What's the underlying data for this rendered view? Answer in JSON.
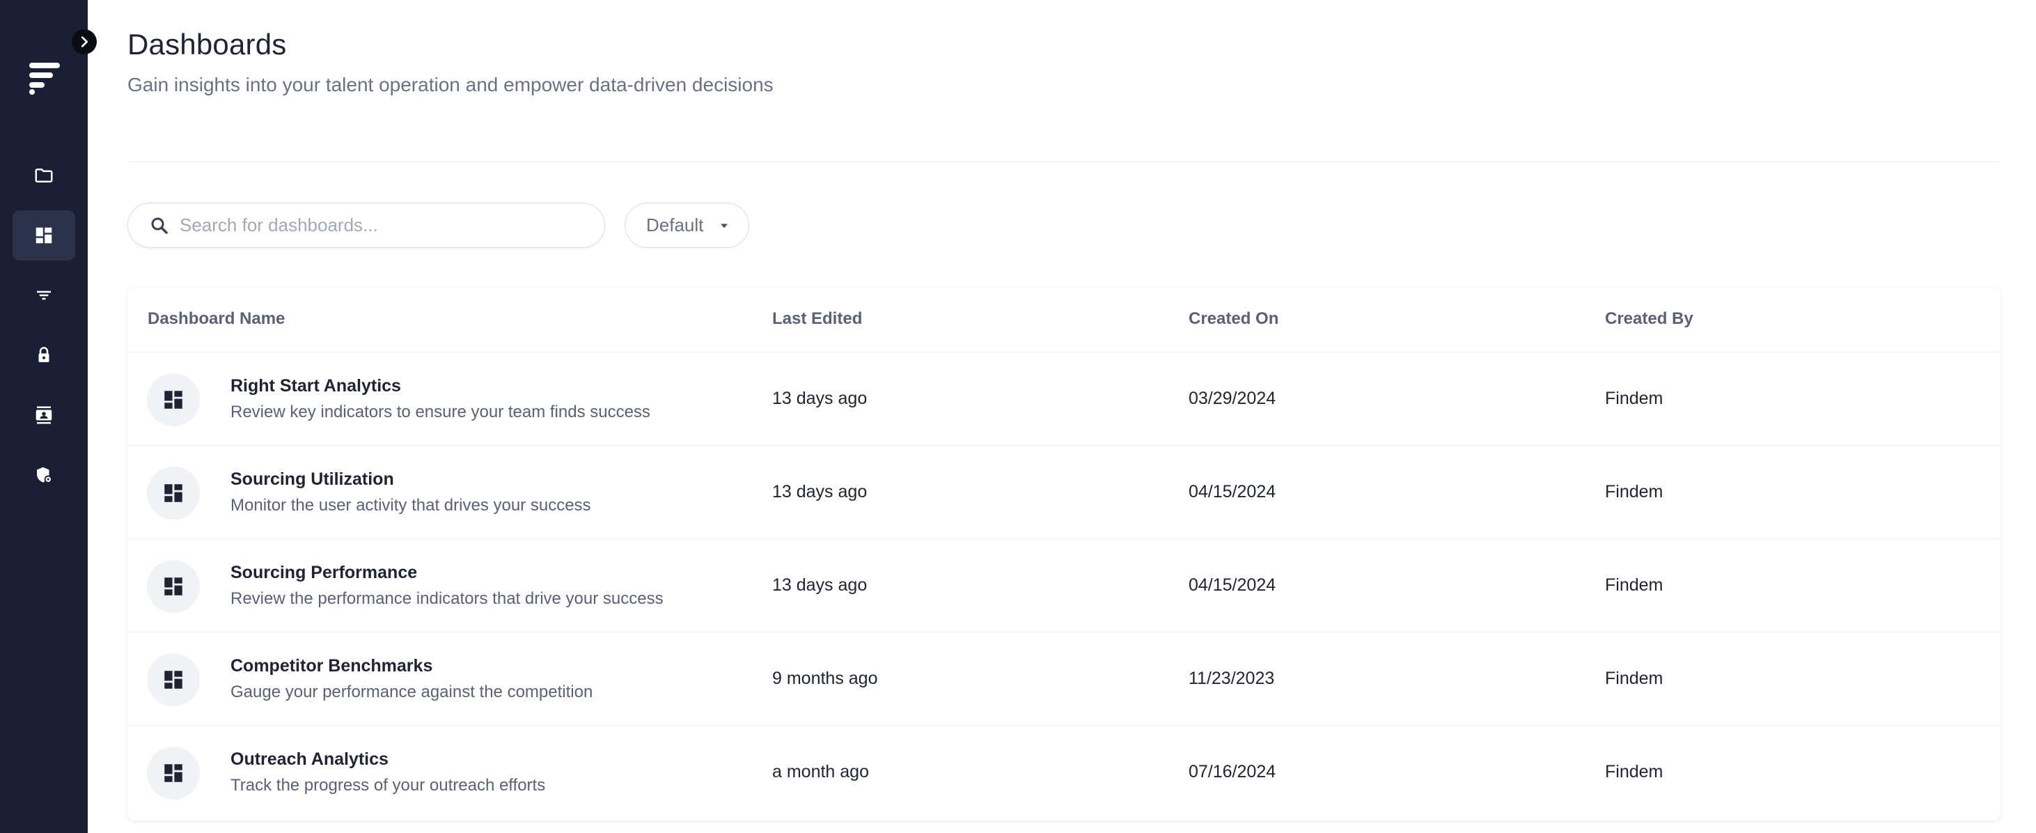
{
  "header": {
    "title": "Dashboards",
    "subtitle": "Gain insights into your talent operation and empower data-driven decisions"
  },
  "sidebar": {
    "items": [
      {
        "icon": "folder-icon",
        "active": false
      },
      {
        "icon": "dashboard-icon",
        "active": true
      },
      {
        "icon": "filter-icon",
        "active": false
      },
      {
        "icon": "lock-icon",
        "active": false
      },
      {
        "icon": "contact-card-icon",
        "active": false
      },
      {
        "icon": "shield-settings-icon",
        "active": false
      }
    ]
  },
  "toolbar": {
    "search_placeholder": "Search for dashboards...",
    "search_value": "",
    "sort_selected": "Default"
  },
  "table": {
    "columns": [
      "Dashboard Name",
      "Last Edited",
      "Created On",
      "Created By"
    ],
    "rows": [
      {
        "name": "Right Start Analytics",
        "description": "Review key indicators to ensure your team finds success",
        "last_edited": "13 days ago",
        "created_on": "03/29/2024",
        "created_by": "Findem"
      },
      {
        "name": "Sourcing Utilization",
        "description": "Monitor the user activity that drives your success",
        "last_edited": "13 days ago",
        "created_on": "04/15/2024",
        "created_by": "Findem"
      },
      {
        "name": "Sourcing Performance",
        "description": "Review the performance indicators that drive your success",
        "last_edited": "13 days ago",
        "created_on": "04/15/2024",
        "created_by": "Findem"
      },
      {
        "name": "Competitor Benchmarks",
        "description": "Gauge your performance against the competition",
        "last_edited": "9 months ago",
        "created_on": "11/23/2023",
        "created_by": "Findem"
      },
      {
        "name": "Outreach Analytics",
        "description": "Track the progress of your outreach efforts",
        "last_edited": "a month ago",
        "created_on": "07/16/2024",
        "created_by": "Findem"
      }
    ]
  },
  "colors": {
    "sidebar_bg": "#1a1f33",
    "sidebar_active": "#2c3249",
    "text_primary": "#1f2333",
    "text_secondary": "#6a7185"
  }
}
